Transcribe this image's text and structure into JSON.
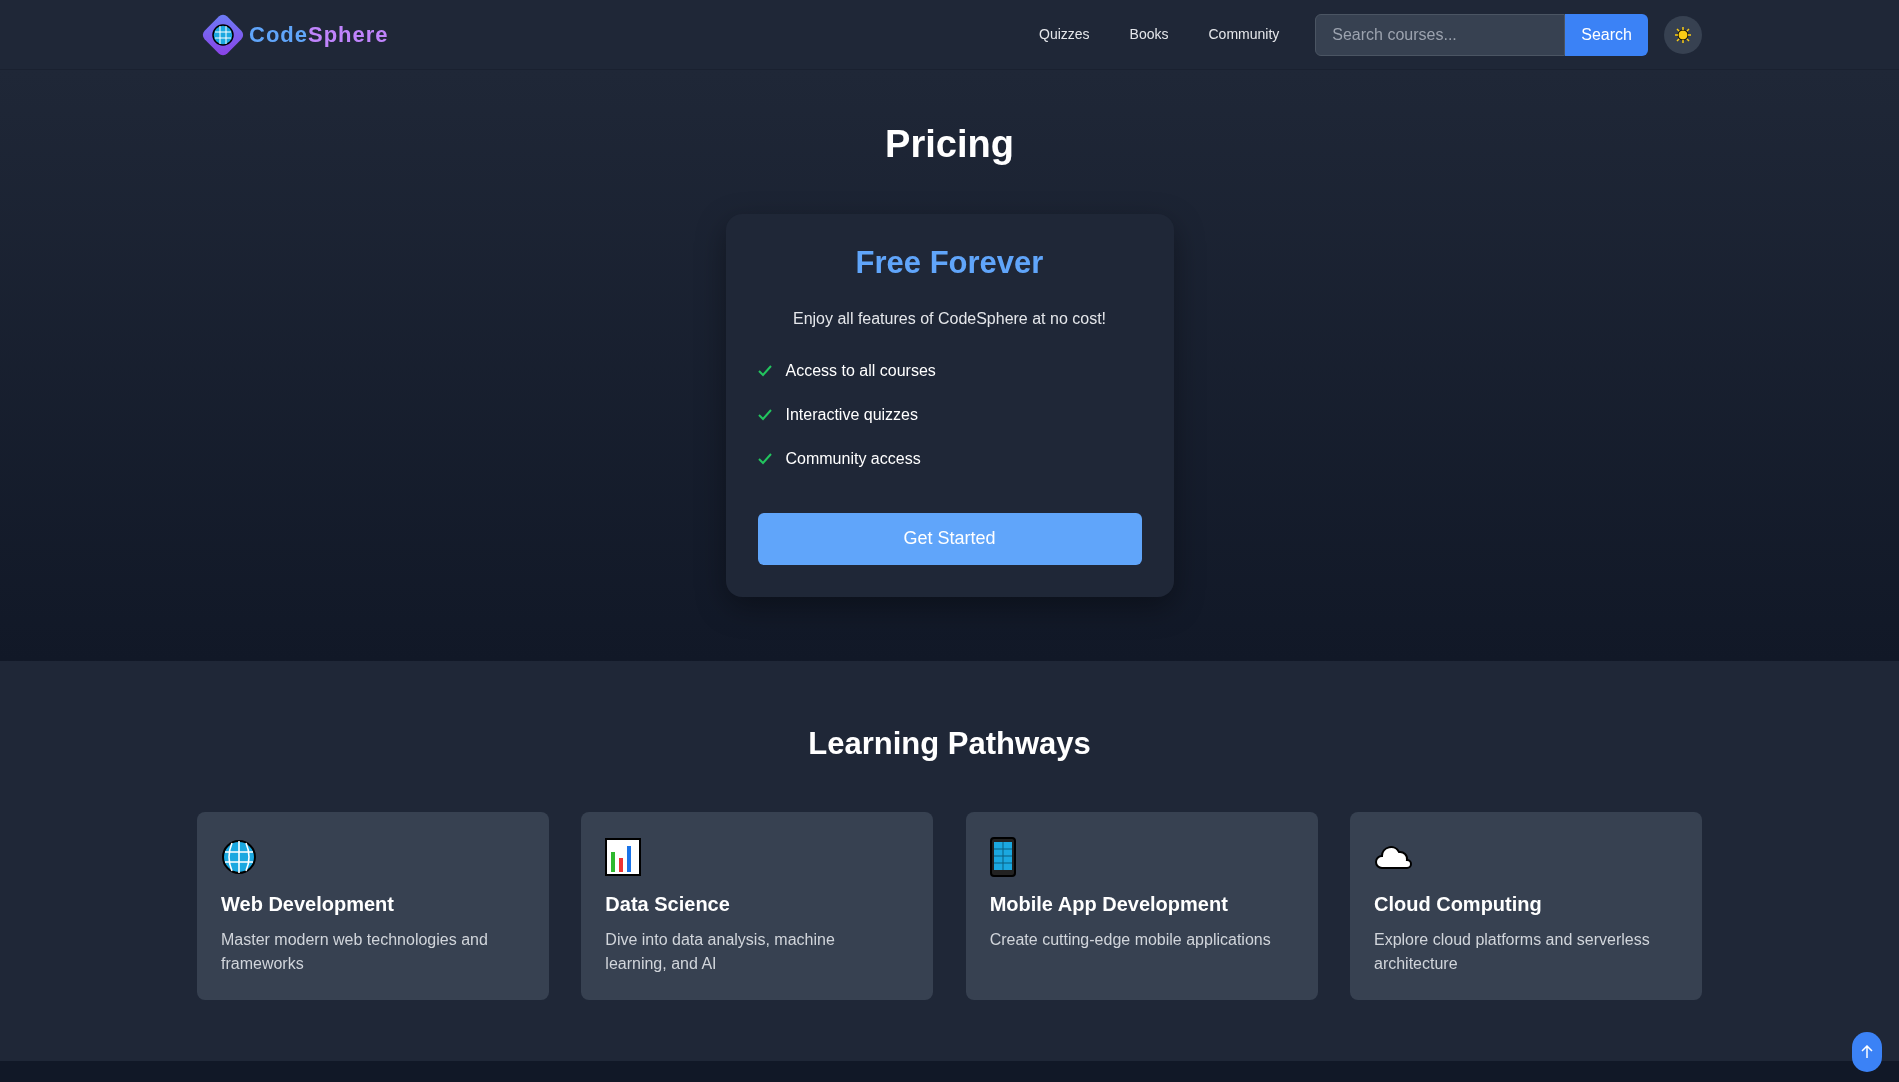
{
  "navbar": {
    "brand": {
      "first": "Code",
      "second": "Sphere"
    },
    "links": [
      "Quizzes",
      "Books",
      "Community"
    ],
    "search": {
      "placeholder": "Search courses...",
      "button": "Search"
    }
  },
  "pricing": {
    "title": "Pricing",
    "plan": {
      "name": "Free Forever",
      "description": "Enjoy all features of CodeSphere at no cost!",
      "features": [
        "Access to all courses",
        "Interactive quizzes",
        "Community access"
      ],
      "button": "Get Started"
    }
  },
  "pathways": {
    "title": "Learning Pathways",
    "items": [
      {
        "title": "Web Development",
        "description": "Master modern web technologies and frameworks"
      },
      {
        "title": "Data Science",
        "description": "Dive into data analysis, machine learning, and AI"
      },
      {
        "title": "Mobile App Development",
        "description": "Create cutting-edge mobile applications"
      },
      {
        "title": "Cloud Computing",
        "description": "Explore cloud platforms and serverless architecture"
      }
    ]
  }
}
